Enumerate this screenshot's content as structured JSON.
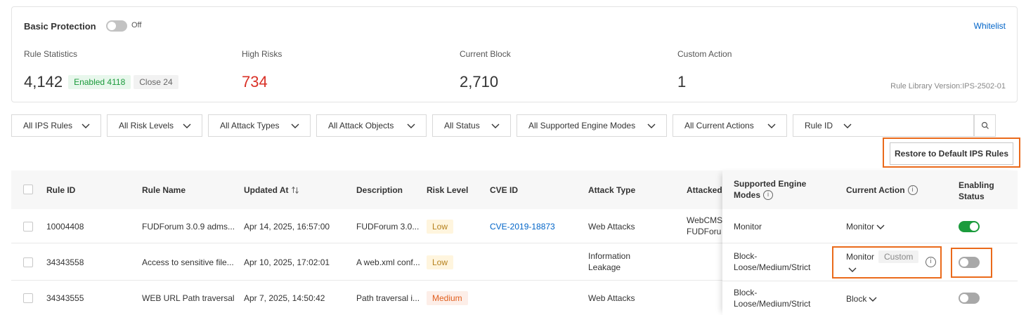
{
  "protection": {
    "title": "Basic Protection",
    "toggle_text": "Off",
    "whitelist": "Whitelist",
    "stats": {
      "rules_label": "Rule Statistics",
      "rules_value": "4,142",
      "enabled_tag": "Enabled 4118",
      "closed_tag": "Close 24",
      "high_label": "High Risks",
      "high_value": "734",
      "block_label": "Current Block",
      "block_value": "2,710",
      "custom_label": "Custom Action",
      "custom_value": "1"
    },
    "version": "Rule Library Version:IPS-2502-01"
  },
  "filters": {
    "ips_rules": "All IPS Rules",
    "risk_levels": "All Risk Levels",
    "attack_types": "All Attack Types",
    "attack_objects": "All Attack Objects",
    "status": "All Status",
    "engine_modes": "All Supported Engine Modes",
    "current_actions": "All Current Actions",
    "rule_id": "Rule ID"
  },
  "restore_button": "Restore to Default IPS Rules",
  "table": {
    "headers": {
      "rule_id": "Rule ID",
      "rule_name": "Rule Name",
      "updated_at": "Updated At",
      "description": "Description",
      "risk_level": "Risk Level",
      "cve_id": "CVE ID",
      "attack_type": "Attack Type",
      "attacked": "Attacked",
      "engine_modes_1": "Supported Engine",
      "engine_modes_2": "Modes",
      "current_action": "Current Action",
      "enabling_1": "Enabling",
      "enabling_2": "Status"
    },
    "rows": [
      {
        "rule_id": "10004408",
        "rule_name": "FUDForum 3.0.9 adms...",
        "updated_at": "Apr 14, 2025, 16:57:00",
        "description": "FUDForum 3.0...",
        "risk": "Low",
        "cve": "CVE-2019-18873",
        "attack_type_1": "Web Attacks",
        "attack_type_2": "",
        "attacked_1": "WebCMS",
        "attacked_2": "FUDForu",
        "engine_1": "Monitor",
        "engine_2": "",
        "action": "Monitor",
        "custom": "",
        "enabled": true
      },
      {
        "rule_id": "34343558",
        "rule_name": "Access to sensitive file...",
        "updated_at": "Apr 10, 2025, 17:02:01",
        "description": "A web.xml conf...",
        "risk": "Low",
        "cve": "",
        "attack_type_1": "Information",
        "attack_type_2": "Leakage",
        "attacked_1": "",
        "attacked_2": "",
        "engine_1": "Block-",
        "engine_2": "Loose/Medium/Strict",
        "action": "Monitor",
        "custom": "Custom",
        "enabled": false
      },
      {
        "rule_id": "34343555",
        "rule_name": "WEB URL Path traversal",
        "updated_at": "Apr 7, 2025, 14:50:42",
        "description": "Path traversal i...",
        "risk": "Medium",
        "cve": "",
        "attack_type_1": "Web Attacks",
        "attack_type_2": "",
        "attacked_1": "",
        "attacked_2": "",
        "engine_1": "Block-",
        "engine_2": "Loose/Medium/Strict",
        "action": "Block",
        "custom": "",
        "enabled": false
      }
    ]
  },
  "colors": {
    "accent_link": "#0064c8",
    "toggle_on": "#1b9b3c",
    "high_risk": "#d93026",
    "highlight_box": "#ea6a1b"
  },
  "icons": [
    "chevron-down-icon",
    "search-icon",
    "info-icon",
    "sort-icon"
  ]
}
